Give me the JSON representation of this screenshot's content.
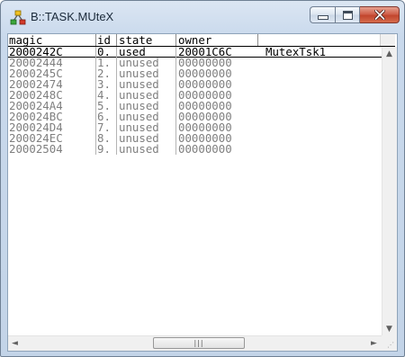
{
  "window": {
    "title": "B::TASK.MUteX",
    "icon": "app-task-icon",
    "buttons": {
      "minimize": "minimize-icon",
      "maximize": "maximize-icon",
      "close": "close-icon"
    }
  },
  "table": {
    "columns": [
      "magic",
      "id",
      "state",
      "owner"
    ],
    "rows": [
      {
        "magic": "2000242C",
        "id": "0.",
        "state": "used",
        "owner": "20001C6C",
        "name": "MutexTsk1"
      },
      {
        "magic": "20002444",
        "id": "1.",
        "state": "unused",
        "owner": "00000000",
        "name": ""
      },
      {
        "magic": "2000245C",
        "id": "2.",
        "state": "unused",
        "owner": "00000000",
        "name": ""
      },
      {
        "magic": "20002474",
        "id": "3.",
        "state": "unused",
        "owner": "00000000",
        "name": ""
      },
      {
        "magic": "2000248C",
        "id": "4.",
        "state": "unused",
        "owner": "00000000",
        "name": ""
      },
      {
        "magic": "200024A4",
        "id": "5.",
        "state": "unused",
        "owner": "00000000",
        "name": ""
      },
      {
        "magic": "200024BC",
        "id": "6.",
        "state": "unused",
        "owner": "00000000",
        "name": ""
      },
      {
        "magic": "200024D4",
        "id": "7.",
        "state": "unused",
        "owner": "00000000",
        "name": ""
      },
      {
        "magic": "200024EC",
        "id": "8.",
        "state": "unused",
        "owner": "00000000",
        "name": ""
      },
      {
        "magic": "20002504",
        "id": "9.",
        "state": "unused",
        "owner": "00000000",
        "name": ""
      }
    ]
  },
  "scrollbars": {
    "up": "▲",
    "down": "▼",
    "left": "◄",
    "right": "►",
    "grip": "|||",
    "size_grip": "⋰"
  },
  "colors": {
    "used_text": "#000000",
    "unused_text": "#7f7f7f",
    "close_button": "#c2452d"
  }
}
